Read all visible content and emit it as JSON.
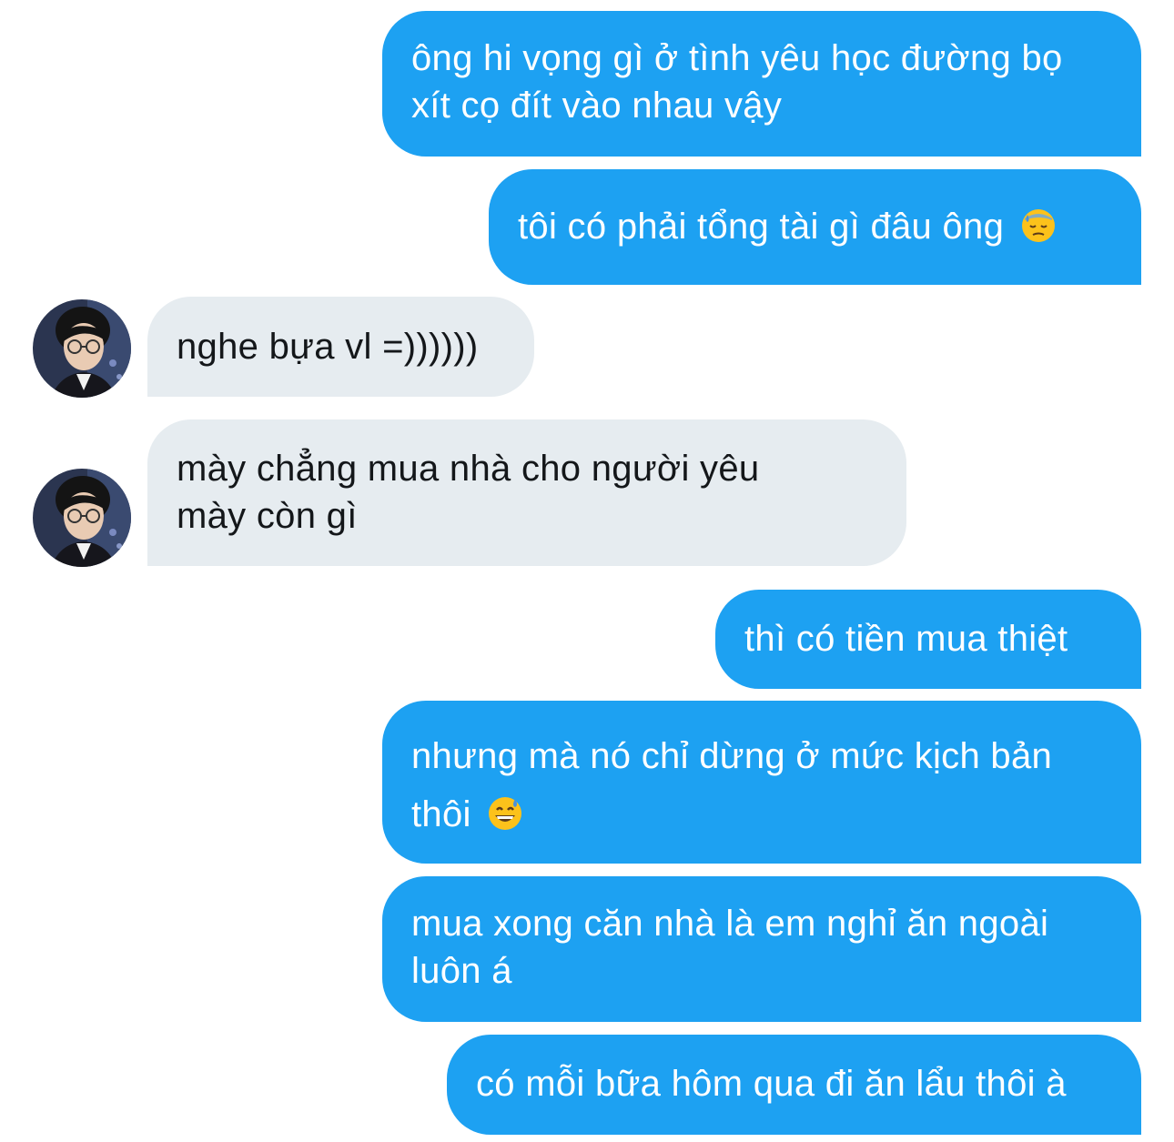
{
  "conversation": {
    "messages": [
      {
        "sender": "me",
        "lines": [
          "ông hi vọng gì ở tình yêu học đường bọ",
          "xít cọ đít vào nhau vậy"
        ]
      },
      {
        "sender": "me",
        "lines": [
          "tôi có phải tổng tài gì đâu ông"
        ],
        "emoji": "downcast-face-with-sweat"
      },
      {
        "sender": "contact",
        "lines": [
          "nghe bựa vl =))))))"
        ]
      },
      {
        "sender": "contact",
        "lines": [
          "mày chẳng mua nhà cho người yêu",
          "mày còn gì"
        ]
      },
      {
        "sender": "me",
        "lines": [
          "thì có tiền mua thiệt"
        ]
      },
      {
        "sender": "me",
        "lines": [
          "nhưng mà nó chỉ dừng ở mức kịch bản",
          "thôi"
        ],
        "emoji": "grinning-face-with-sweat"
      },
      {
        "sender": "me",
        "lines": [
          "mua xong căn nhà là em nghỉ ăn ngoài",
          "luôn á"
        ]
      },
      {
        "sender": "me",
        "lines": [
          "có mỗi bữa hôm qua đi ăn lẩu thôi à"
        ]
      }
    ]
  },
  "colors": {
    "outgoing_bubble": "#1da1f2",
    "incoming_bubble": "#e6ecf0",
    "outgoing_text": "#ffffff",
    "incoming_text": "#14171a"
  }
}
